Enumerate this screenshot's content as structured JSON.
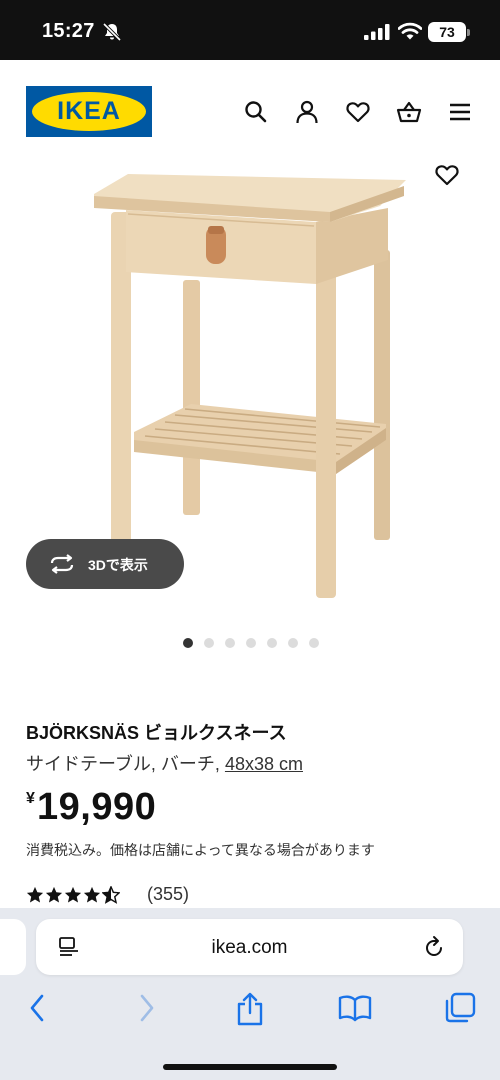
{
  "status_bar": {
    "time": "15:27",
    "battery": "73",
    "icons": [
      "bell-slash-icon",
      "signal-bars-icon",
      "wifi-icon",
      "battery-icon"
    ]
  },
  "header": {
    "logo_text": "IKEA",
    "colors": {
      "brand_blue": "#0058a3",
      "brand_yellow": "#ffdb00"
    },
    "icons": [
      "search-icon",
      "user-icon",
      "heart-icon",
      "basket-icon",
      "menu-icon"
    ]
  },
  "gallery": {
    "view_3d_label": "3Dで表示",
    "dot_count": 7,
    "active_dot": 1
  },
  "product": {
    "name": "BJÖRKSNÄS ビョルクスネース",
    "description": "サイドテーブル, バーチ, ",
    "size": "48x38 cm",
    "currency": "¥",
    "price": "19,990",
    "tax_note": "消費税込み。価格は店舗によって異なる場合があります",
    "rating": 4.5,
    "review_count": "(355)"
  },
  "browser": {
    "url": "ikea.com",
    "toolbar_icons": [
      "back-icon",
      "forward-icon",
      "share-icon",
      "bookmarks-icon",
      "tabs-icon"
    ]
  }
}
